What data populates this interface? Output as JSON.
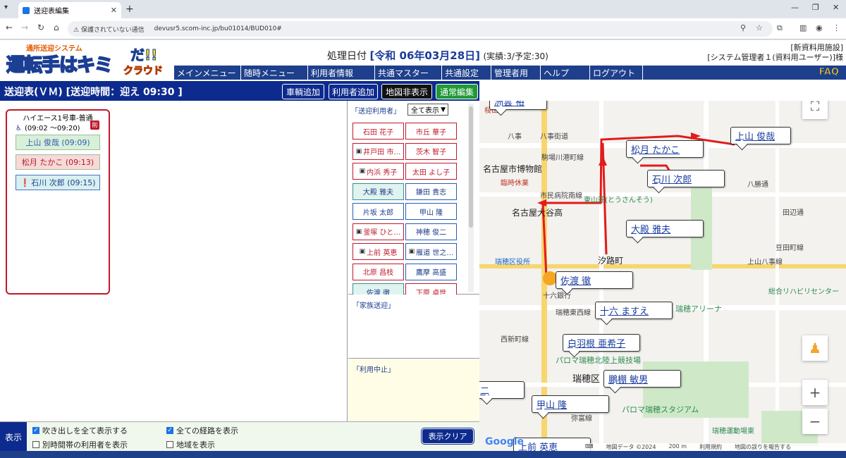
{
  "browser": {
    "tab_title": "送迎表編集",
    "url_warning": "保護されていない通信",
    "url": "devusr5.scom-inc.jp/bu01014/BUD010#"
  },
  "header": {
    "logo_sub": "通所送迎システム",
    "logo_main": "運転手はキミ",
    "logo_da": "だ!!",
    "logo_cloud": "クラウド",
    "proc_date_label": "処理日付",
    "proc_date": "[令和 06年03月28日]",
    "proc_result": "(実績:3/予定:30)",
    "facility": "[新資料用施設]",
    "user": "[システム管理者１(資料用ユーザー)]様"
  },
  "menu": [
    "メインメニュー",
    "随時メニュー",
    "利用者情報",
    "共通マスター",
    "共通設定",
    "管理者用",
    "ヘルプ",
    "ログアウト"
  ],
  "faq_label": "FAQ",
  "title": "送迎表(ＶＭ) [送迎時間：迎え 09:30 ]",
  "toolbar": {
    "add_vehicle": "車輌追加",
    "add_user": "利用者追加",
    "hide_map": "地図非表示",
    "normal_edit": "通常編集"
  },
  "vehicle": {
    "name": "ハイエース1号車-普通",
    "time": "(09:02 ～09:20)",
    "delete_label": "削",
    "passengers": [
      {
        "label": "上山 俊哉 (09:09)",
        "style": "green"
      },
      {
        "label": "松月 たかこ (09:13)",
        "style": "pink"
      },
      {
        "label": "石川 次郎 (09:15)",
        "style": "blue"
      }
    ]
  },
  "user_panel": {
    "header": "「送迎利用者」",
    "filter": "全て表示",
    "users": [
      {
        "label": "石田 花子",
        "style": "red",
        "icon": false
      },
      {
        "label": "市丘 華子",
        "style": "red",
        "icon": false
      },
      {
        "label": "井戸田 市…",
        "style": "red",
        "icon": true
      },
      {
        "label": "茨木 智子",
        "style": "red",
        "icon": false
      },
      {
        "label": "内浜 秀子",
        "style": "red",
        "icon": true
      },
      {
        "label": "太田 よし子",
        "style": "red",
        "icon": false
      },
      {
        "label": "大殿 雅夫",
        "style": "green",
        "icon": false
      },
      {
        "label": "鎌田 貴志",
        "style": "blue",
        "icon": false
      },
      {
        "label": "片坂 太郎",
        "style": "blue",
        "icon": false
      },
      {
        "label": "甲山 隆",
        "style": "blue",
        "icon": false
      },
      {
        "label": "釜塚 ひと…",
        "style": "red",
        "icon": true
      },
      {
        "label": "神穂 俊二",
        "style": "blue",
        "icon": false
      },
      {
        "label": "上前 英恵",
        "style": "red",
        "icon": true
      },
      {
        "label": "雁道 世之…",
        "style": "blue",
        "icon": true
      },
      {
        "label": "北原 昌枝",
        "style": "red",
        "icon": false
      },
      {
        "label": "鷹摩 高盛",
        "style": "blue",
        "icon": false
      },
      {
        "label": "佐渡 徹",
        "style": "green",
        "icon": false
      },
      {
        "label": "下原 卓世",
        "style": "red",
        "icon": false
      }
    ]
  },
  "family_header": "「家族送迎」",
  "suspend_header": "「利用中止」",
  "map": {
    "callouts": [
      "洲雲 裕",
      "上山 俊哉",
      "松月 たかこ",
      "石川 次郎",
      "大殿 雅夫",
      "佐渡 徹",
      "十六 ますえ",
      "白羽根 亜希子",
      "鵬棚 敏男",
      "甲山 隆",
      "上前 英恵",
      "二"
    ],
    "labels": [
      "桜山",
      "八事街道",
      "駒場川港町線",
      "名古屋市博物館",
      "臨時休業",
      "市民病院南線",
      "東山荘(とうさんそう)",
      "名古屋大谷高",
      "瑞穂区役所",
      "汐路町",
      "十六銀行",
      "瑞穂東西線",
      "瑞穂アリーナ",
      "パロマ瑞穂北陸上競技場",
      "瑞穂区",
      "パロマ瑞穂スタジアム",
      "瑞穂運動場東",
      "上山八事線",
      "豆田町線",
      "総合リハビリセンター",
      "田辺通",
      "八事",
      "西新町線",
      "弥富線",
      "八勝通"
    ],
    "attrib": [
      "地図データ ©2024",
      "200 m",
      "利用規約",
      "地図の誤りを報告する"
    ],
    "google": "Google"
  },
  "bottom": {
    "show_button": "表示",
    "cb_balloons": "吹き出しを全て表示する",
    "cb_routes": "全ての経路を表示",
    "cb_other": "別時間帯の利用者を表示",
    "cb_area": "地域を表示",
    "clear_button": "表示クリア"
  },
  "colors": {
    "navy": "#0d2b8e",
    "route": "#e21b1b",
    "vehicle_border": "#c0192c"
  }
}
